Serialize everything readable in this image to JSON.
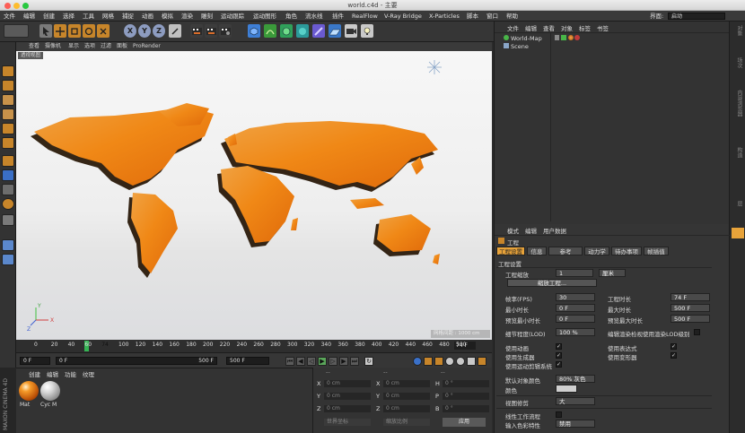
{
  "window": {
    "title": "world.c4d - 主要"
  },
  "menubar": {
    "items": [
      "文件",
      "编辑",
      "创建",
      "选择",
      "工具",
      "网格",
      "捕捉",
      "动画",
      "模拟",
      "渲染",
      "雕刻",
      "运动跟踪",
      "运动图形",
      "角色",
      "流水线",
      "插件",
      "RealFlow",
      "V-Ray Bridge",
      "X-Particles",
      "脚本",
      "窗口",
      "帮助"
    ],
    "layout_label": "界面:",
    "layout_value": "启动"
  },
  "toolbar": {
    "x_label": "X",
    "y_label": "Y",
    "z_label": "Z"
  },
  "viewport": {
    "menu": [
      "查看",
      "摄像机",
      "显示",
      "选项",
      "过滤",
      "面板",
      "ProRender"
    ],
    "view_tag": "透视视图",
    "grid_label": "网格间距 : 1000 cm",
    "axis_x": "X",
    "axis_y": "Y",
    "axis_z": "Z"
  },
  "timeline": {
    "ticks": [
      "0",
      "20",
      "40",
      "60",
      "74",
      "100",
      "120",
      "140",
      "160",
      "180",
      "200",
      "220",
      "240",
      "260",
      "280",
      "300",
      "320",
      "340",
      "360",
      "380",
      "400",
      "420",
      "440",
      "460",
      "480",
      "500"
    ],
    "current_frame": "74 F"
  },
  "transport": {
    "start": "0 F",
    "preview_min": "0 F",
    "preview_max": "500 F",
    "end": "500 F"
  },
  "materials": {
    "menu": [
      "创建",
      "编辑",
      "功能",
      "纹理"
    ],
    "items": [
      {
        "label": "Mat"
      },
      {
        "label": "Cyc M"
      }
    ],
    "brand": "MAXON CINEMA 4D"
  },
  "coordinates": {
    "header": [
      "--",
      "--",
      "--"
    ],
    "rows": [
      {
        "a": "X",
        "av": "0 cm",
        "b": "X",
        "bv": "0 cm",
        "c": "H",
        "cv": "0 °"
      },
      {
        "a": "Y",
        "av": "0 cm",
        "b": "Y",
        "bv": "0 cm",
        "c": "P",
        "cv": "0 °"
      },
      {
        "a": "Z",
        "av": "0 cm",
        "b": "Z",
        "bv": "0 cm",
        "c": "B",
        "cv": "0 °"
      }
    ],
    "mode1": "世界坐标",
    "mode2": "缩放比例",
    "apply": "应用"
  },
  "objects": {
    "menu": [
      "文件",
      "编辑",
      "查看",
      "对象",
      "标签",
      "书签"
    ],
    "items": [
      {
        "name": "World-Map"
      },
      {
        "name": "Scene"
      }
    ]
  },
  "right_tabs": [
    "对象",
    "场次",
    "内容浏览器",
    "构造",
    "层"
  ],
  "attributes": {
    "menu": [
      "模式",
      "编辑",
      "用户数据"
    ],
    "header": "工程",
    "tabs": [
      "工程设置",
      "信息",
      "参考",
      "动力学",
      "待办事项",
      "帧插值"
    ],
    "section": "工程设置",
    "scale_label": "工程缩放",
    "scale_value": "1",
    "scale_unit": "厘米",
    "scale_button": "缩放工程...",
    "left_fields": [
      {
        "label": "帧率(FPS)",
        "value": "30"
      },
      {
        "label": "最小时长",
        "value": "0 F"
      },
      {
        "label": "预览最小时长",
        "value": "0 F"
      },
      {
        "label": "细节程度(LOD)",
        "value": "100 %"
      }
    ],
    "right_fields": [
      {
        "label": "工程时长",
        "value": "74 F"
      },
      {
        "label": "最大时长",
        "value": "500 F"
      },
      {
        "label": "预览最大时长",
        "value": "500 F"
      }
    ],
    "lod_option": "编辑渲染检视使用渲染LOD级别",
    "checks_left": [
      "使用动画",
      "使用生成器",
      "使用运动剪辑系统"
    ],
    "checks_right": [
      "使用表达式",
      "使用变形器"
    ],
    "default_color_label": "默认对象颜色",
    "default_color_value": "80% 灰色",
    "color_label": "颜色",
    "view_clip_label": "视图修剪",
    "view_clip_value": "大",
    "linear_label": "线性工作流程",
    "input_color_label": "输入色彩特性",
    "input_color_value": "禁用"
  },
  "colors": {
    "accent": "#f0a020",
    "playhead": "#35b454",
    "map": "#f08a18"
  }
}
